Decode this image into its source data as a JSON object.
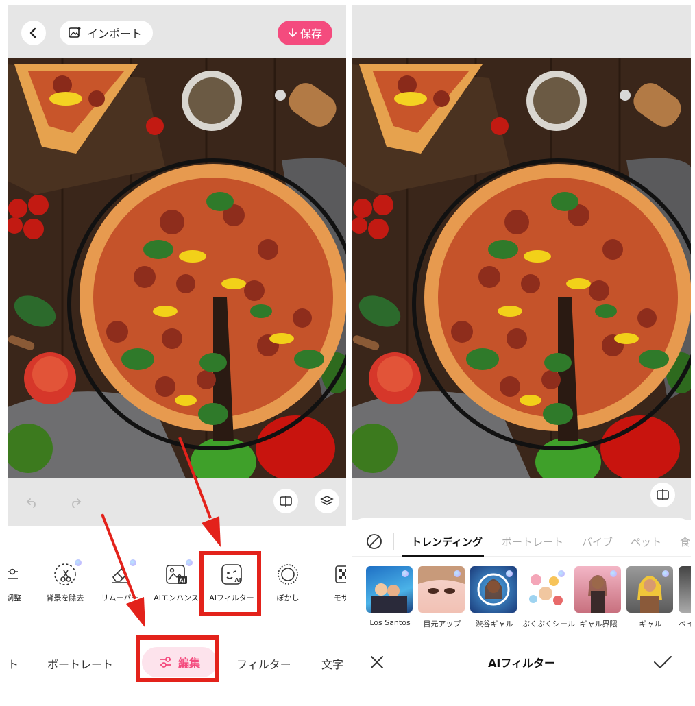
{
  "left": {
    "import_label": "インポート",
    "save_label": "保存",
    "tools": [
      {
        "label": "調整",
        "icon": "adjust-icon"
      },
      {
        "label": "背景を除去",
        "icon": "scissors-icon",
        "premium": true
      },
      {
        "label": "リムーバー",
        "icon": "eraser-icon",
        "premium": true
      },
      {
        "label": "AIエンハンス",
        "icon": "ai-enhance-icon",
        "premium": true
      },
      {
        "label": "AIフィルター",
        "icon": "ai-filter-icon"
      },
      {
        "label": "ぼかし",
        "icon": "blur-icon"
      },
      {
        "label": "モザイク",
        "icon": "mosaic-icon"
      }
    ],
    "tabs": [
      {
        "label": "ト"
      },
      {
        "label": "ポートレート"
      },
      {
        "label": "編集"
      },
      {
        "label": "フィルター"
      },
      {
        "label": "文字"
      }
    ]
  },
  "right": {
    "tabs": [
      {
        "label": "トレンディング"
      },
      {
        "label": "ポートレート"
      },
      {
        "label": "バイブ"
      },
      {
        "label": "ペット"
      },
      {
        "label": "食"
      }
    ],
    "filters": [
      {
        "label": "Los Santos"
      },
      {
        "label": "目元アップ"
      },
      {
        "label": "渋谷ギャル"
      },
      {
        "label": "ぷくぷくシール"
      },
      {
        "label": "ギャル界隈"
      },
      {
        "label": "ギャル"
      },
      {
        "label": "ベイ"
      }
    ],
    "title": "AIフィルター"
  },
  "colors": {
    "accent": "#f44b7e",
    "highlight": "#e3221b",
    "gray_bar": "#e6e6e6"
  }
}
